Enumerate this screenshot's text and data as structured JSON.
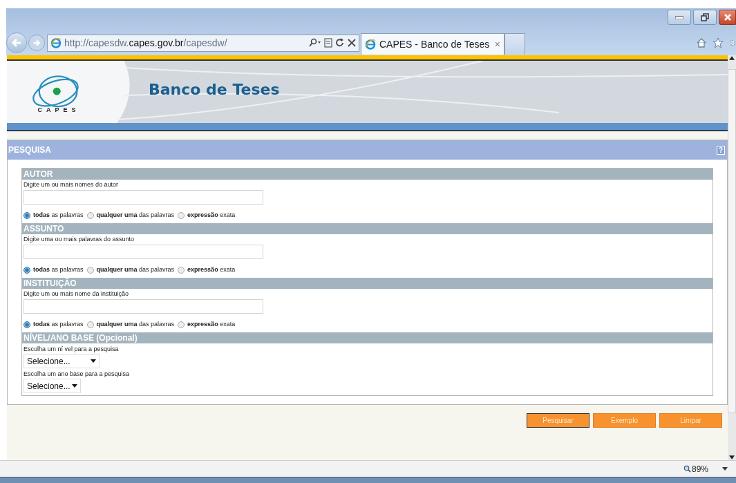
{
  "browser": {
    "url": {
      "prefix": "http://capesdw.",
      "domain": "capes.gov.br",
      "path": "/capesdw/"
    },
    "tabs": [
      {
        "title": "CAPES - Banco de Teses",
        "close": "×",
        "selected": true
      }
    ],
    "zoom": "89%"
  },
  "header": {
    "logo_text": "CAPES",
    "title": "Banco de Teses"
  },
  "panel": {
    "title": "PESQUISA",
    "help": "?",
    "sections": [
      {
        "kind": "text",
        "title": "AUTOR",
        "label": "Digite um ou mais nomes do autor",
        "options": [
          {
            "label": "**todas** as palavras",
            "selected": true
          },
          {
            "label": "**qualquer uma** das palavras",
            "selected": false
          },
          {
            "label": "**expressão** exata",
            "selected": false
          }
        ]
      },
      {
        "kind": "text",
        "title": "ASSUNTO",
        "label": "Digite uma ou mais palavras do assunto",
        "options": [
          {
            "label": "**todas** as palavras",
            "selected": true
          },
          {
            "label": "**qualquer uma** das palavras",
            "selected": false
          },
          {
            "label": "**expressão** exata",
            "selected": false
          }
        ]
      },
      {
        "kind": "text",
        "title": "INSTITUIÇÃO",
        "label": "Digite um ou mais nome da instituição",
        "options": [
          {
            "label": "**todas** as palavras",
            "selected": true
          },
          {
            "label": "**qualquer uma** das palavras",
            "selected": false
          },
          {
            "label": "**expressão** exata",
            "selected": false
          }
        ]
      },
      {
        "kind": "selects",
        "title": "NÍVEL/ANO BASE (Opcional)",
        "selects": [
          {
            "label": "Escolha um ní vel para a pesquisa",
            "value": "Selecione..."
          },
          {
            "label": "Escolha um ano base para a pesquisa",
            "value": "Selecione..."
          }
        ]
      }
    ]
  },
  "buttons": [
    {
      "label": "Pesquisar",
      "focused": true
    },
    {
      "label": "Exemplo",
      "focused": false
    },
    {
      "label": "Limpar",
      "focused": false
    }
  ]
}
